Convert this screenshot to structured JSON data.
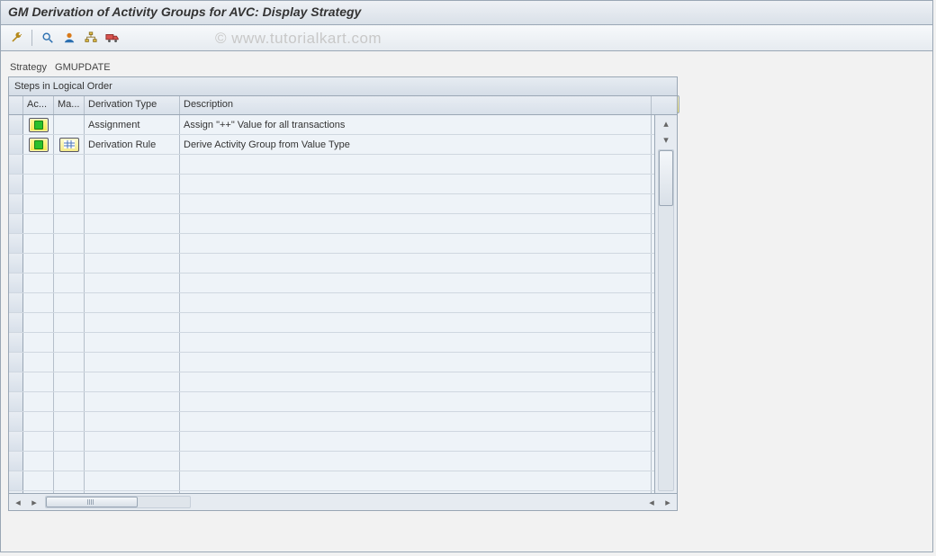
{
  "title": "GM Derivation of Activity Groups for AVC: Display Strategy",
  "watermark": "© www.tutorialkart.com",
  "toolbar": {
    "icons": [
      "wrench-icon",
      "find-icon",
      "user-icon",
      "org-icon",
      "transport-icon"
    ]
  },
  "strategy": {
    "label": "Strategy",
    "value": "GMUPDATE"
  },
  "panel_title": "Steps in Logical Order",
  "columns": {
    "ac": "Ac...",
    "ma": "Ma...",
    "dt": "Derivation Type",
    "de": "Description"
  },
  "rows": [
    {
      "active": true,
      "maint": false,
      "type": "Assignment",
      "desc": "Assign \"++\" Value for all transactions"
    },
    {
      "active": true,
      "maint": true,
      "type": "Derivation Rule",
      "desc": "Derive Activity Group from Value Type"
    }
  ],
  "empty_row_count": 18
}
